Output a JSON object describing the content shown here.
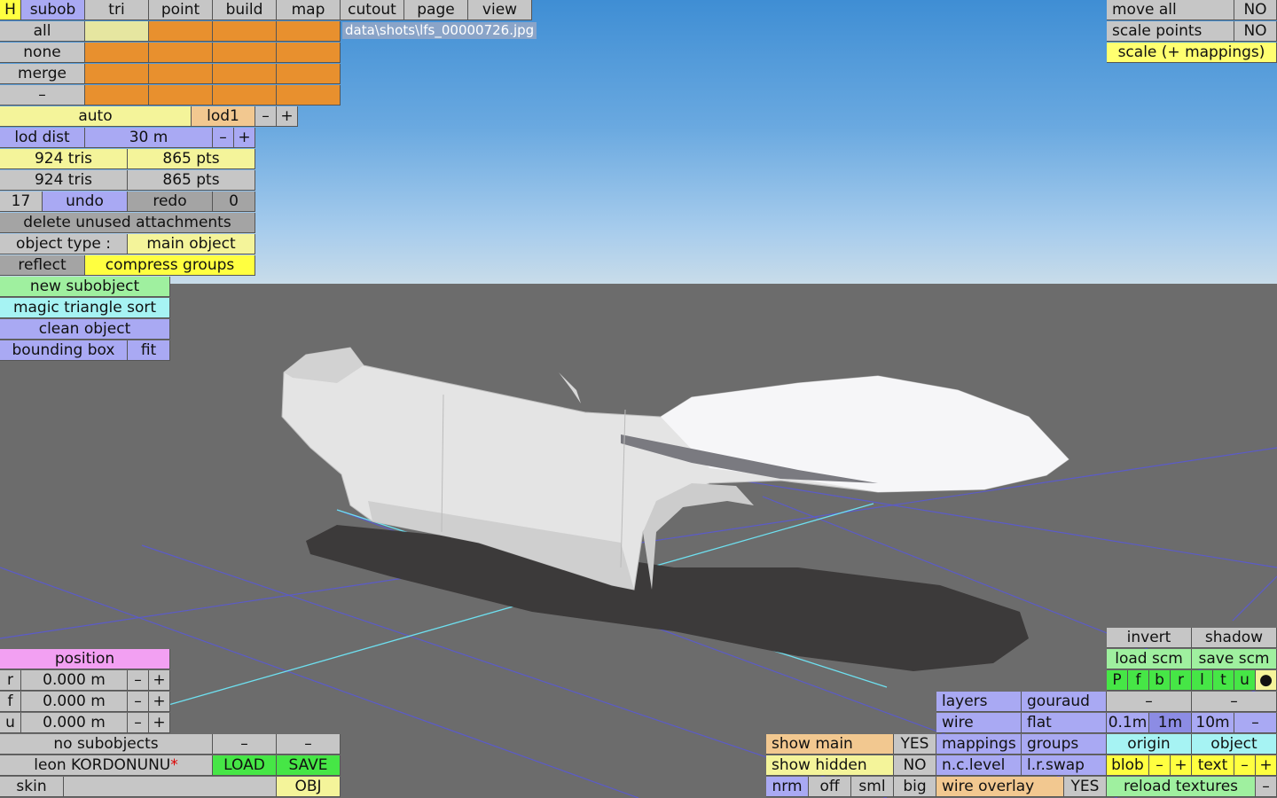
{
  "menu": {
    "h": "H",
    "tabs": [
      "subob",
      "tri",
      "point",
      "build",
      "map",
      "cutout",
      "page",
      "view"
    ]
  },
  "filename": "data\\shots\\lfs_00000726.jpg",
  "select": {
    "all": "all",
    "none": "none",
    "merge": "merge",
    "dash": "–"
  },
  "lod": {
    "auto": "auto",
    "level": "lod1",
    "minus": "–",
    "plus": "+",
    "dist_label": "lod dist",
    "dist_value": "30 m"
  },
  "counts": {
    "tris1": "924 tris",
    "pts1": "865 pts",
    "tris2": "924 tris",
    "pts2": "865 pts"
  },
  "undo": {
    "num_left": "17",
    "undo": "undo",
    "redo": "redo",
    "num_right": "0"
  },
  "actions": {
    "delete_unused": "delete unused attachments",
    "object_type_label": "object type :",
    "object_type_value": "main object",
    "reflect": "reflect",
    "compress": "compress groups",
    "new_subobject": "new subobject",
    "magic_sort": "magic triangle sort",
    "clean_object": "clean object",
    "bounding_box": "bounding box",
    "fit": "fit"
  },
  "top_right": {
    "move_all": "move all",
    "move_all_val": "NO",
    "scale_points": "scale points",
    "scale_points_val": "NO",
    "scale_mappings": "scale (+ mappings)"
  },
  "position": {
    "title": "position",
    "rows": [
      {
        "axis": "r",
        "value": "0.000 m"
      },
      {
        "axis": "f",
        "value": "0.000 m"
      },
      {
        "axis": "u",
        "value": "0.000 m"
      }
    ],
    "minus": "–",
    "plus": "+"
  },
  "bottom_left": {
    "no_subobjects": "no subobjects",
    "dash1": "–",
    "dash2": "–",
    "author": "leon KORDONUNU",
    "asterisk": "*",
    "load": "LOAD",
    "save": "SAVE",
    "skin": "skin",
    "obj": "OBJ"
  },
  "show": {
    "show_main": "show main",
    "show_main_val": "YES",
    "show_hidden": "show hidden",
    "show_hidden_val": "NO",
    "nrm": "nrm",
    "off": "off",
    "sml": "sml",
    "big": "big"
  },
  "render": {
    "layers": "layers",
    "gouraud": "gouraud",
    "wire": "wire",
    "flat": "flat",
    "mappings": "mappings",
    "groups": "groups",
    "nc_level": "n.c.level",
    "lr_swap": "l.r.swap",
    "wire_overlay": "wire overlay",
    "wire_overlay_val": "YES"
  },
  "right_panel": {
    "invert": "invert",
    "shadow": "shadow",
    "load_scm": "load scm",
    "save_scm": "save scm",
    "letters": [
      "P",
      "f",
      "b",
      "r",
      "l",
      "t",
      "u"
    ],
    "dot": "●",
    "dash1": "–",
    "dash2": "–",
    "grid": [
      "0.1m",
      "1m",
      "10m",
      "–"
    ],
    "origin": "origin",
    "object": "object",
    "blob": "blob",
    "minus": "–",
    "plus": "+",
    "text": "text",
    "reload": "reload textures"
  },
  "colors": {
    "orange": "#e8902e",
    "yellow": "#f4f49a",
    "blue": "#a9a9f3",
    "green": "#9ff09f",
    "cyan": "#a6f3f3",
    "pink": "#f2a0f2"
  }
}
